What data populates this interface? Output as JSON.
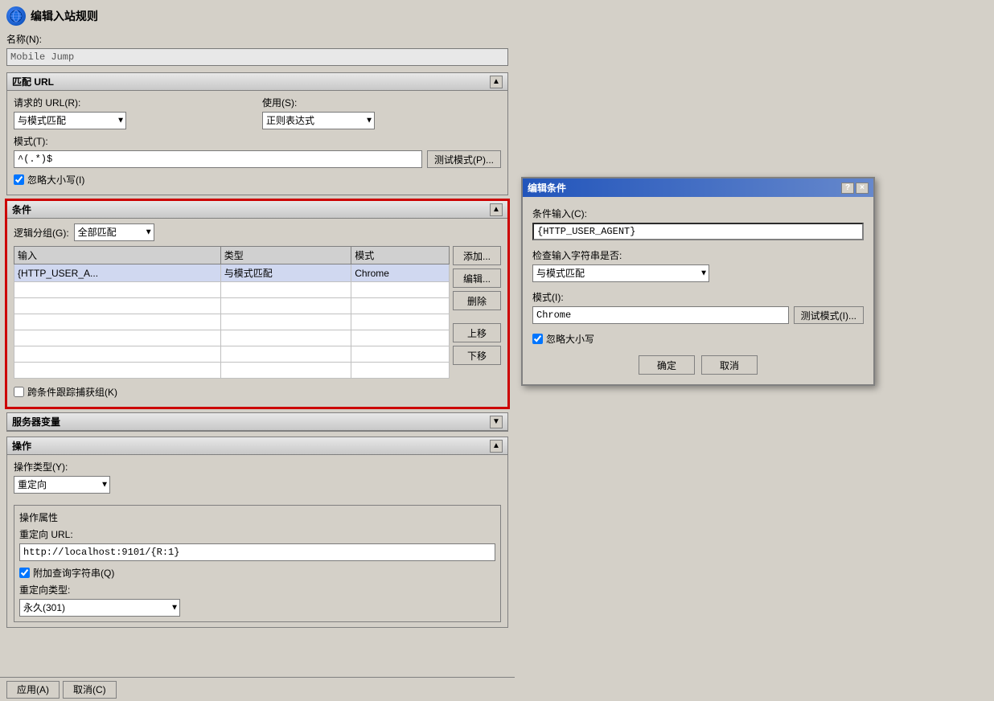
{
  "main_window": {
    "title": "编辑入站规则",
    "name_label": "名称(N):",
    "name_value": "Mobile Jump",
    "match_url_section": {
      "label": "匹配 URL",
      "request_url_label": "请求的 URL(R):",
      "request_url_options": [
        "与模式匹配"
      ],
      "request_url_selected": "与模式匹配",
      "use_label": "使用(S):",
      "use_options": [
        "正则表达式"
      ],
      "use_selected": "正则表达式",
      "pattern_label": "模式(T):",
      "pattern_value": "^(.*)$",
      "test_btn_label": "测试模式(P)...",
      "ignore_case_label": "忽略大小写(I)",
      "ignore_case_checked": true
    },
    "conditions_section": {
      "label": "条件",
      "logic_group_label": "逻辑分组(G):",
      "logic_group_options": [
        "全部匹配"
      ],
      "logic_group_selected": "全部匹配",
      "table_headers": [
        "输入",
        "类型",
        "模式"
      ],
      "table_rows": [
        {
          "input": "{HTTP_USER_A...",
          "type": "与模式匹配",
          "pattern": "Chrome"
        },
        {
          "input": "",
          "type": "",
          "pattern": ""
        },
        {
          "input": "",
          "type": "",
          "pattern": ""
        },
        {
          "input": "",
          "type": "",
          "pattern": ""
        },
        {
          "input": "",
          "type": "",
          "pattern": ""
        },
        {
          "input": "",
          "type": "",
          "pattern": ""
        },
        {
          "input": "",
          "type": "",
          "pattern": ""
        }
      ],
      "add_btn": "添加...",
      "edit_btn": "编辑...",
      "delete_btn": "删除",
      "up_btn": "上移",
      "down_btn": "下移",
      "track_capture_label": "跨条件跟踪捕获组(K)",
      "track_capture_checked": false
    },
    "server_vars_section": {
      "label": "服务器变量"
    },
    "operations_section": {
      "label": "操作",
      "type_label": "操作类型(Y):",
      "type_options": [
        "重定向"
      ],
      "type_selected": "重定向",
      "props_group_label": "操作属性",
      "redirect_url_label": "重定向 URL:",
      "redirect_url_value": "http://localhost:9101/{R:1}",
      "append_query_label": "附加查询字符串(Q)",
      "append_query_checked": true,
      "redirect_type_label": "重定向类型:",
      "redirect_type_options": [
        "永久(301)"
      ],
      "redirect_type_selected": "永久(301)"
    }
  },
  "bottom_bar": {
    "apply_btn": "应用(A)",
    "cancel_btn": "取消(C)"
  },
  "dialog": {
    "title": "编辑条件",
    "question_btn": "?",
    "close_btn": "×",
    "condition_input_label": "条件输入(C):",
    "condition_input_value": "{HTTP_USER_AGENT}",
    "check_string_label": "检查输入字符串是否:",
    "check_options": [
      "与模式匹配"
    ],
    "check_selected": "与模式匹配",
    "pattern_label": "模式(I):",
    "pattern_value": "Chrome",
    "test_btn_label": "测试模式(I)...",
    "ignore_case_label": "忽略大小写",
    "ignore_case_checked": true,
    "ok_btn": "确定",
    "cancel_btn": "取消"
  }
}
